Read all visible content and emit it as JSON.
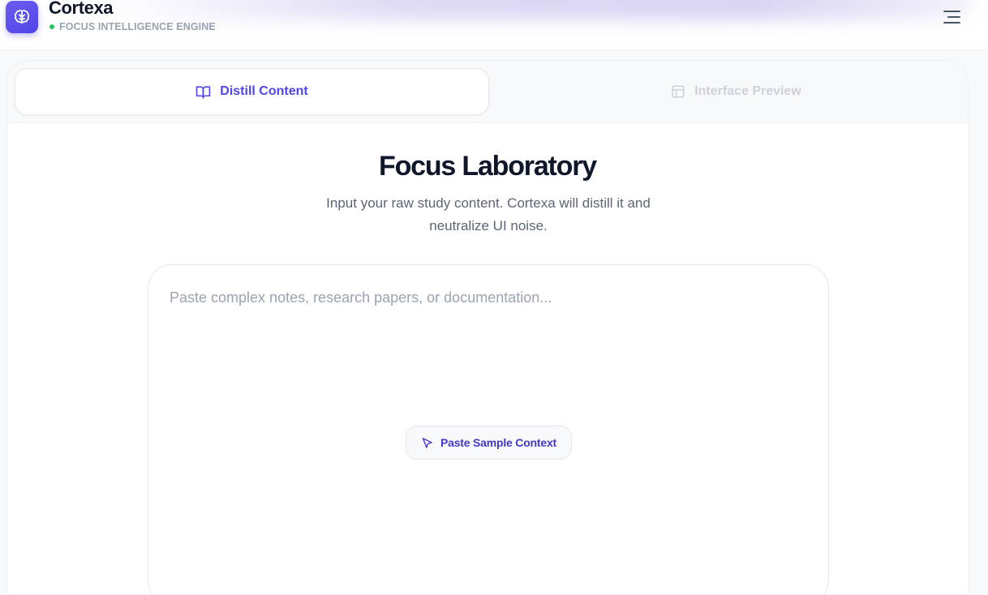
{
  "app": {
    "name": "Cortexa",
    "status": "FOCUS INTELLIGENCE ENGINE",
    "status_color": "#22c55e",
    "brand_color": "#4f46e5"
  },
  "header": {
    "menu_icon": "menu-lines-icon",
    "logo_icon": "brain-icon"
  },
  "tabs": [
    {
      "label": "Distill Content",
      "icon": "book-open-icon",
      "active": true
    },
    {
      "label": "Interface Preview",
      "icon": "layout-icon",
      "active": false
    }
  ],
  "main": {
    "title": "Focus Laboratory",
    "subtitle": "Input your raw study content. Cortexa will distill it and neutralize UI noise.",
    "input": {
      "placeholder": "Paste complex notes, research papers, or documentation...",
      "value": ""
    },
    "sample_button": {
      "label": "Paste Sample Context",
      "icon": "cursor-pointer-icon"
    }
  }
}
